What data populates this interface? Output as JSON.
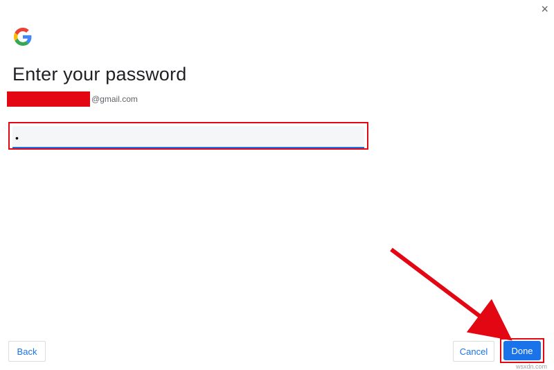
{
  "header": {
    "close_label": "×"
  },
  "title": "Enter your password",
  "account": {
    "email_suffix": "@gmail.com"
  },
  "password": {
    "value": "•",
    "placeholder": ""
  },
  "footer": {
    "back_label": "Back",
    "cancel_label": "Cancel",
    "done_label": "Done"
  },
  "watermark": "wsxdn.com",
  "colors": {
    "accent": "#1a73e8",
    "highlight": "#e30613"
  }
}
